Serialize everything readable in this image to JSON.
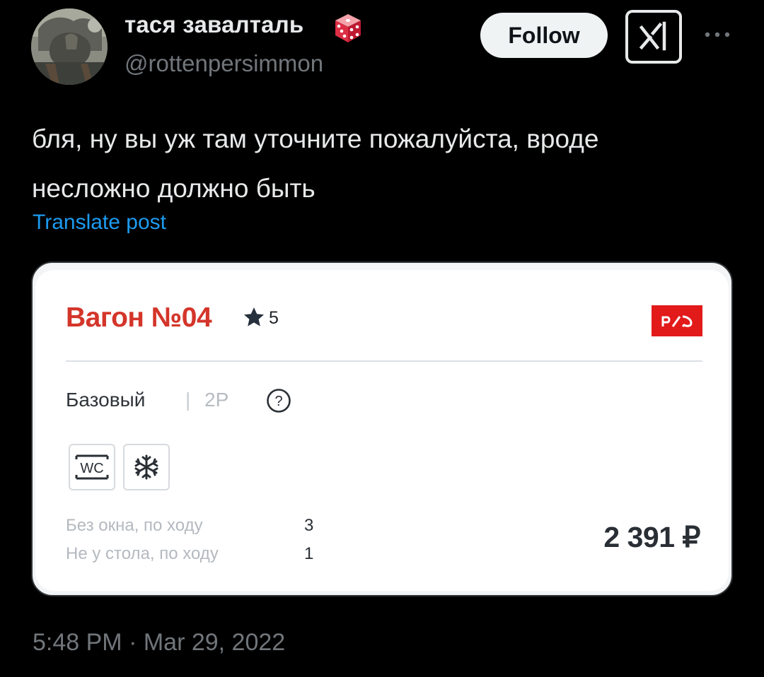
{
  "author": {
    "display_name": "тася завалталь",
    "username": "@rottenpersimmon",
    "badge_icon": "dice-icon",
    "avatar": "avatar-photo"
  },
  "actions": {
    "follow_label": "Follow",
    "grok_icon": "grok-icon",
    "more_icon": "more-icon"
  },
  "post": {
    "text_lines": [
      "бля, ну вы уж там уточните пожалуйста, вроде",
      "несложно должно быть"
    ],
    "translate_label": "Translate post"
  },
  "media": {
    "car_title": "Вагон №04",
    "rating": "5",
    "logo_text": "РЖД",
    "class_name": "Базовый",
    "class_separator": "|",
    "class_code": "2Р",
    "help_glyph": "?",
    "amenities": [
      {
        "icon": "wc-icon",
        "text": "WC"
      },
      {
        "icon": "snowflake-icon"
      }
    ],
    "seats": [
      {
        "label": "Без окна, по ходу",
        "count": "3"
      },
      {
        "label": "Не у стола, по ходу",
        "count": "1"
      }
    ],
    "price": "2 391 ₽"
  },
  "meta": {
    "timestamp": "5:48 PM · Mar 29, 2022"
  },
  "colors": {
    "background": "#000000",
    "text": "#e7e9ea",
    "secondary": "#71767b",
    "link": "#1d9bf0",
    "follow_bg": "#eff3f4",
    "rzd_red": "#e21a1a",
    "car_title": "#d4352a"
  }
}
